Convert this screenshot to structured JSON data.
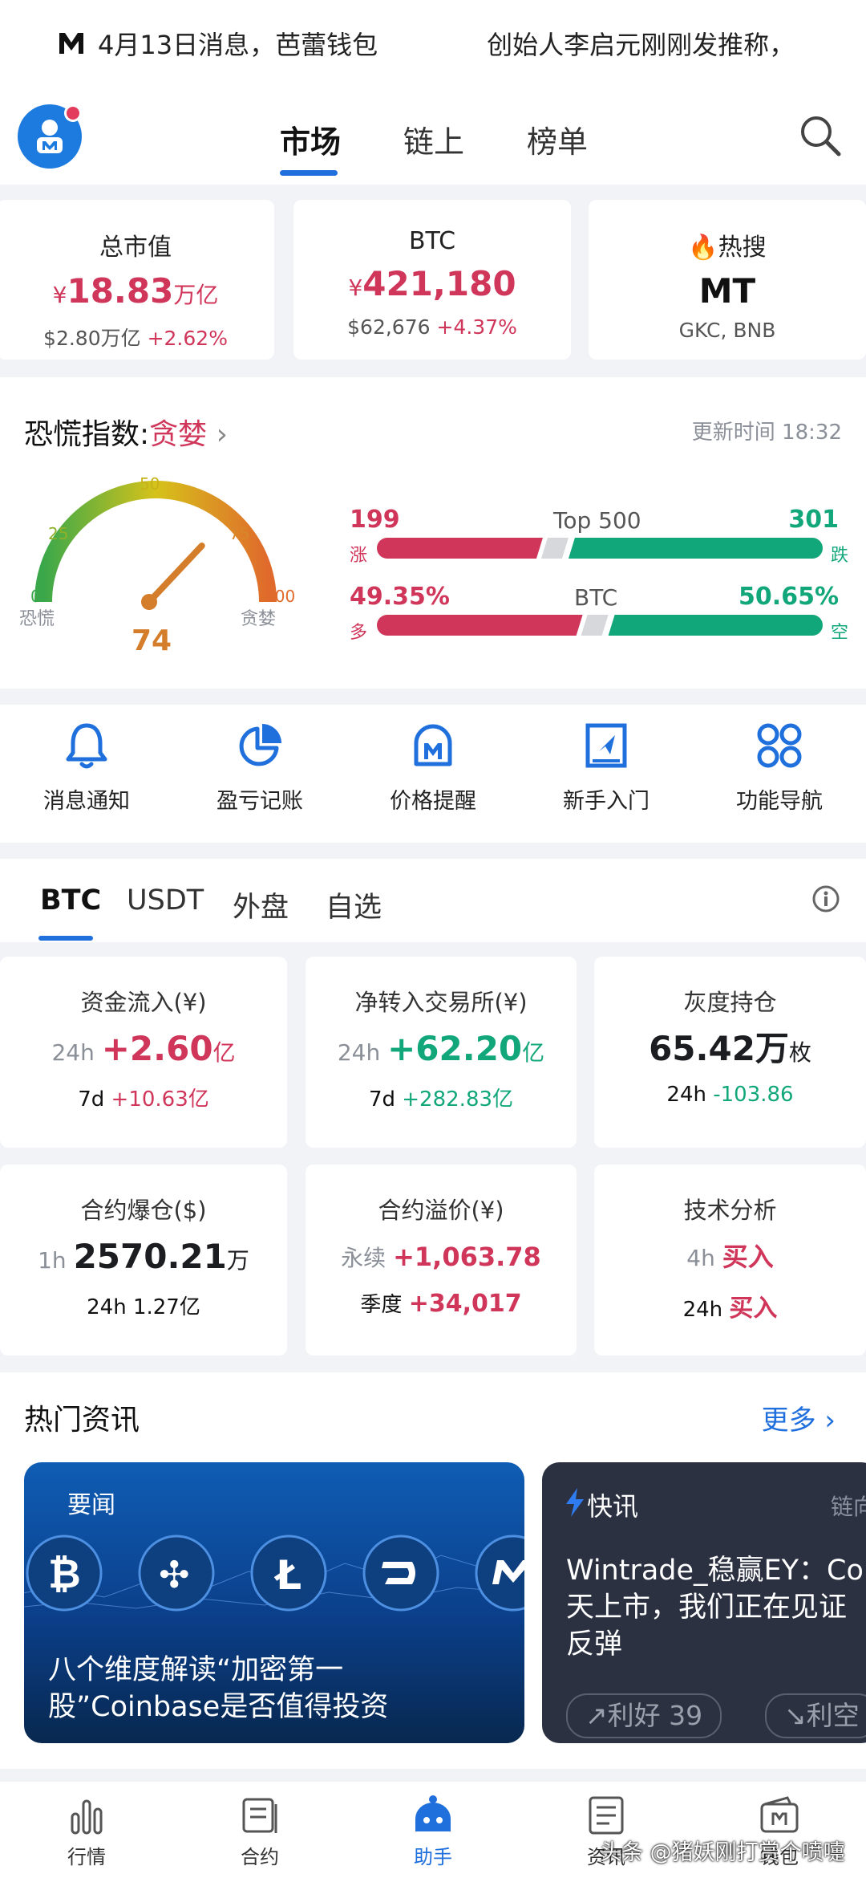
{
  "ticker": {
    "text1": "4月13日消息，芭蕾钱包",
    "text2": "创始人李启元刚刚发推称，"
  },
  "topnav": {
    "tabs": [
      {
        "label": "市场",
        "active": true
      },
      {
        "label": "链上",
        "active": false
      },
      {
        "label": "榜单",
        "active": false
      }
    ]
  },
  "stats": [
    {
      "label": "总市值",
      "currency": "¥",
      "value": "18.83",
      "unit": "万亿",
      "sub_value": "$2.80万亿",
      "sub_change": "+2.62%"
    },
    {
      "label": "BTC",
      "currency": "¥",
      "value": "421,180",
      "unit": "",
      "sub_value": "$62,676",
      "sub_change": "+4.37%"
    },
    {
      "label": "热搜",
      "currency": "",
      "value": "MT",
      "unit": "",
      "sub_value": "GKC, BNB",
      "sub_change": ""
    }
  ],
  "fear_index": {
    "title": "恐慌指数:",
    "state": "贪婪",
    "update_time": "更新时间 18:32",
    "value": "74",
    "value_num": 74,
    "ticks": [
      "0",
      "25",
      "50",
      "75",
      "100"
    ],
    "left_label": "恐慌",
    "right_label": "贪婪",
    "top500": {
      "up": "199",
      "up_label": "涨",
      "title": "Top 500",
      "down": "301",
      "down_label": "跌",
      "up_ratio": 0.398
    },
    "btc": {
      "long": "49.35%",
      "long_label": "多",
      "title": "BTC",
      "short": "50.65%",
      "short_label": "空",
      "long_ratio": 0.4935
    }
  },
  "quick_actions": [
    "消息通知",
    "盈亏记账",
    "价格提醒",
    "新手入门",
    "功能导航"
  ],
  "market_tabs": [
    {
      "label": "BTC",
      "active": true
    },
    {
      "label": "USDT",
      "active": false
    },
    {
      "label": "外盘",
      "active": false
    },
    {
      "label": "自选",
      "active": false
    }
  ],
  "data_cards": [
    {
      "label": "资金流入(¥)",
      "prefix": "24h",
      "value": "+2.60",
      "unit": "亿",
      "sub_prefix": "7d",
      "sub_value": "+10.63亿"
    },
    {
      "label": "净转入交易所(¥)",
      "prefix": "24h",
      "value": "+62.20",
      "unit": "亿",
      "sub_prefix": "7d",
      "sub_value": "+282.83亿"
    },
    {
      "label": "灰度持仓",
      "prefix": "",
      "value": "65.42万",
      "unit": "枚",
      "sub_prefix": "24h",
      "sub_value": "-103.86"
    },
    {
      "label": "合约爆仓($)",
      "prefix": "1h",
      "value": "2570.21",
      "unit": "万",
      "sub_prefix": "24h",
      "sub_value": "1.27亿"
    },
    {
      "label": "合约溢价(¥)",
      "prefix": "永续",
      "value": "+1,063.78",
      "unit": "",
      "sub_prefix": "季度",
      "sub_value": "+34,017"
    },
    {
      "label": "技术分析",
      "prefix": "4h",
      "value": "买入",
      "unit": "",
      "sub_prefix": "24h",
      "sub_value": "买入"
    }
  ],
  "news": {
    "title": "热门资讯",
    "more": "更多",
    "card1": {
      "tag": "要闻",
      "headline": "八个维度解读“加密第一股”Coinbase是否值得投资"
    },
    "card2": {
      "tag": "快讯",
      "tag2": "链向",
      "headline": "Wintrade_稳赢EY：Co\n天上市，我们正在见证\n反弹",
      "bull": "利好 39",
      "bear": "利空"
    }
  },
  "bottom_nav": [
    {
      "label": "行情",
      "active": false
    },
    {
      "label": "合约",
      "active": false
    },
    {
      "label": "助手",
      "active": true
    },
    {
      "label": "资讯",
      "active": false
    },
    {
      "label": "钱包",
      "active": false
    }
  ],
  "watermark": "头条 @猪妖刚打赏个喷嚏",
  "colors": {
    "accent": "#1f6fdd",
    "up": "#d0355a",
    "down": "#12a77a",
    "gauge_needle": "#d47d2a"
  }
}
